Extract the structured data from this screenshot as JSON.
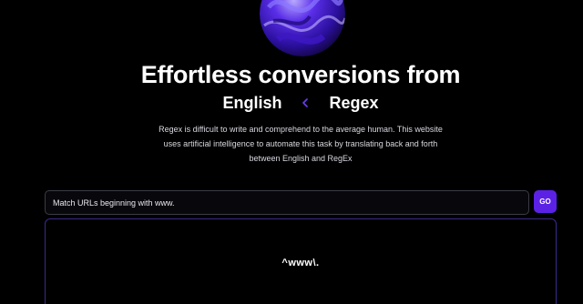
{
  "hero": {
    "headline": "Effortless conversions from",
    "source_language": "English",
    "target_language": "Regex",
    "description": "Regex is difficult to write and comprehend to the average human. This website uses artificial intelligence to automate this task by translating back and forth between English and RegEx"
  },
  "icons": {
    "logo": "abstract-purple-orb",
    "swap": "swap-arrow-icon"
  },
  "converter": {
    "input_value": "Match URLs beginning with www.",
    "go_label": "GO",
    "output_value": "^www\\."
  },
  "colors": {
    "background": "#000000",
    "accent": "#5b22e6",
    "output_border": "#3d2a8a",
    "input_border": "#3b3b46"
  }
}
